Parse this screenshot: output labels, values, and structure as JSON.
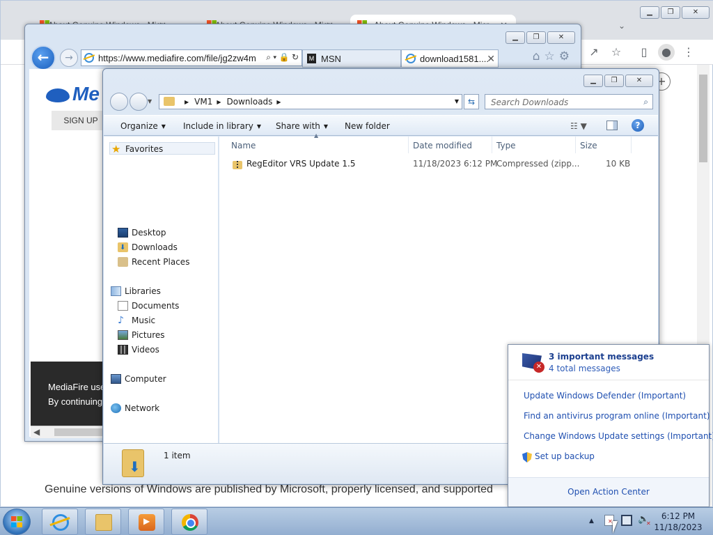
{
  "chrome": {
    "tabs": [
      {
        "title": "About Genuine Windows - Micr..."
      },
      {
        "title": "About Genuine Windows - Micr..."
      },
      {
        "title": "About Genuine Windows - Micr..."
      }
    ],
    "page_text": "Genuine versions of Windows are published by Microsoft, properly licensed, and supported"
  },
  "ie": {
    "address": "https://www.mediafire.com/file/jg2zw4m",
    "tabs": [
      {
        "title": "MSN"
      },
      {
        "title": "download1581...."
      }
    ],
    "page": {
      "logo": "Me",
      "signup_label": "SIGN UP",
      "cookie_line1": "MediaFire use",
      "cookie_line2": "By continuing"
    }
  },
  "explorer": {
    "breadcrumb": [
      "VM1",
      "Downloads"
    ],
    "search_placeholder": "Search Downloads",
    "commands": {
      "organize": "Organize",
      "include": "Include in library",
      "share": "Share with",
      "new_folder": "New folder"
    },
    "nav": {
      "favorites": "Favorites",
      "desktop": "Desktop",
      "downloads": "Downloads",
      "recent": "Recent Places",
      "libraries": "Libraries",
      "documents": "Documents",
      "music": "Music",
      "pictures": "Pictures",
      "videos": "Videos",
      "computer": "Computer",
      "network": "Network"
    },
    "columns": {
      "name": "Name",
      "date": "Date modified",
      "type": "Type",
      "size": "Size"
    },
    "files": [
      {
        "name": "RegEditor VRS Update 1.5",
        "date": "11/18/2023 6:12 PM",
        "type": "Compressed (zipp...",
        "size": "10 KB"
      }
    ],
    "item_count": "1 item"
  },
  "action_center": {
    "title": "3 important messages",
    "subtitle": "4 total messages",
    "links": [
      "Update Windows Defender (Important)",
      "Find an antivirus program online (Important)",
      "Change Windows Update settings (Important)",
      "Set up backup"
    ],
    "footer": "Open Action Center"
  },
  "taskbar": {
    "time": "6:12 PM",
    "date": "11/18/2023"
  }
}
